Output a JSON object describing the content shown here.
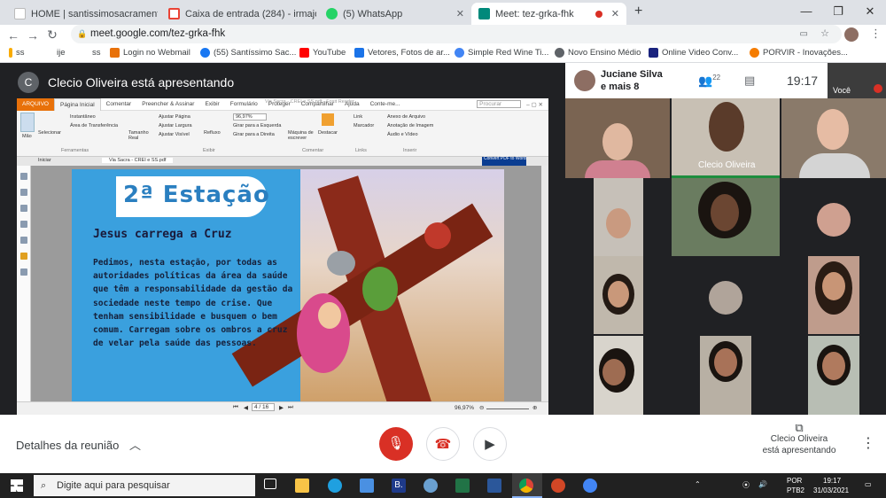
{
  "browser": {
    "tabs": [
      {
        "title": "HOME | santissimosacramento"
      },
      {
        "title": "Caixa de entrada (284) - irmajosy"
      },
      {
        "title": "(5) WhatsApp"
      },
      {
        "title": "Meet: tez-grka-fhk"
      }
    ],
    "new_tab": "+",
    "url": "meet.google.com/tez-grka-fhk",
    "bookmarks": [
      {
        "label": "ss"
      },
      {
        "label": "ije"
      },
      {
        "label": "ss"
      },
      {
        "label": "Login no Webmail"
      },
      {
        "label": "(55) Santíssimo Sac..."
      },
      {
        "label": "YouTube"
      },
      {
        "label": "Vetores, Fotos de ar..."
      },
      {
        "label": "Simple Red Wine Ti..."
      },
      {
        "label": "Novo Ensino Médio"
      },
      {
        "label": "Online Video Conv..."
      },
      {
        "label": "PORVIR - Inovações..."
      }
    ]
  },
  "meet": {
    "presenter_initial": "C",
    "presenter_banner": "Clecio Oliveira está apresentando",
    "top_name": "Juciane Silva",
    "top_sub": "e mais 8",
    "participants_count": "22",
    "time": "19:17",
    "self_label": "Você",
    "tile_name": "Clecio Oliveira",
    "details_label": "Detalhes da reunião",
    "presenting_line1": "Clecio Oliveira",
    "presenting_line2": "está apresentando"
  },
  "reader": {
    "menu": [
      "ARQUIVO",
      "Página Inicial",
      "Comentar",
      "Preencher & Assinar",
      "Exibir",
      "Formulário",
      "Proteger",
      "Compartilhar",
      "Ajuda",
      "Conte-me..."
    ],
    "search_placeholder": "Procurar",
    "title_bar": "Via Sacra - CREI e SS.pdf - Foxit Reader",
    "ribbon": {
      "mao": "Mão",
      "selecionar": "Selecionar",
      "instantaneo": "Instantâneo",
      "area": "Área de Transferência",
      "ferramentas": "Ferramentas",
      "tamanho": "Tamanho Real",
      "ajustar_pagina": "Ajustar Página",
      "ajustar_largura": "Ajustar Largura",
      "ajustar_visivel": "Ajustar Visível",
      "refluxo": "Refluxo",
      "zoom": "96,97%",
      "girar_esq": "Girar para a Esquerda",
      "girar_dir": "Girar para a Direita",
      "exibir": "Exibir",
      "maquina": "Máquina de escrever",
      "destacar": "Destacar",
      "comentar": "Comentar",
      "link": "Link",
      "marcador": "Marcador",
      "links": "Links",
      "anexo": "Anexo de Arquivo",
      "anotacao": "Anotação de Imagem",
      "audio": "Áudio e Vídeo",
      "inserir": "Inserir"
    },
    "doc_tabs": [
      "Iniciar",
      "Via Sacra - CREI e SS.pdf"
    ],
    "convert": "Convert PDF to Word",
    "page_indicator": "4 / 16",
    "zoom_status": "96,97%"
  },
  "page": {
    "station_title": "2ª Estação",
    "subtitle": "Jesus carrega a Cruz",
    "body": "Pedimos, nesta estação, por todas as autoridades políticas da área da saúde que têm a responsabilidade da gestão da sociedade neste tempo de crise. Que tenham sensibilidade e busquem o bem comum. Carregam sobre os ombros a cruz de velar pela saúde das pessoas."
  },
  "taskbar": {
    "search_placeholder": "Digite aqui para pesquisar",
    "lang1": "POR",
    "lang2": "PTB2",
    "time": "19:17",
    "date": "31/03/2021"
  }
}
